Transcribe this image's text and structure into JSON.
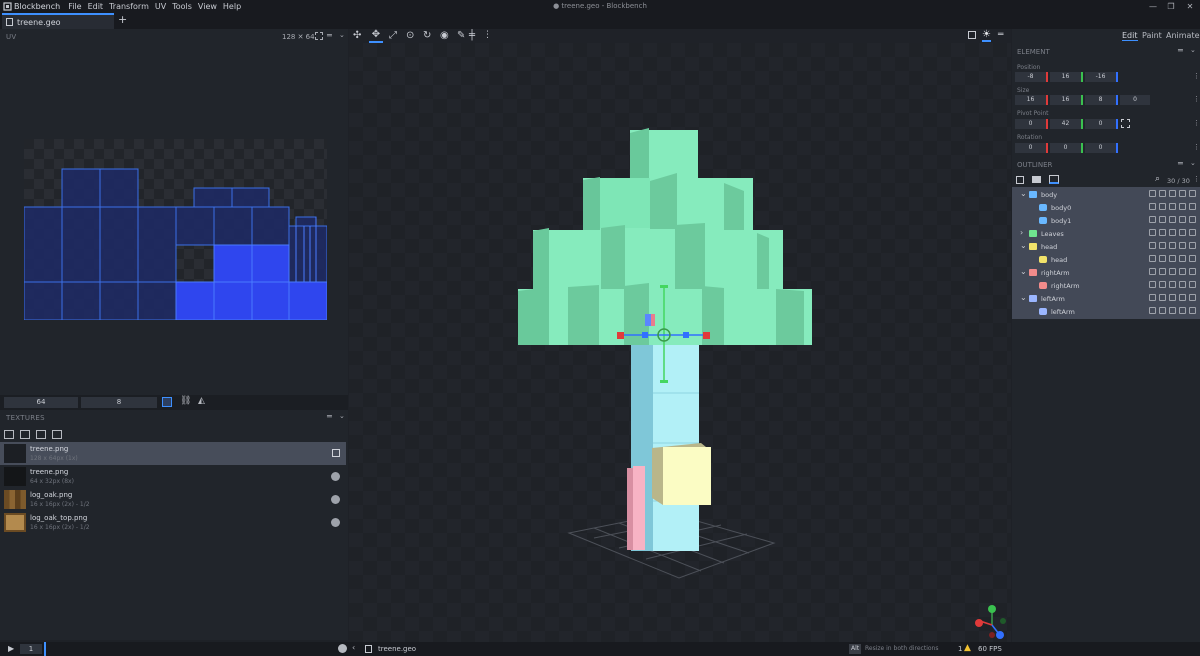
{
  "app": {
    "name": "Blockbench",
    "window_title": "● treene.geo - Blockbench",
    "menus": [
      "File",
      "Edit",
      "Transform",
      "UV",
      "Tools",
      "View",
      "Help"
    ]
  },
  "tabs": [
    {
      "label": "treene.geo"
    }
  ],
  "uv": {
    "title": "UV",
    "resolution": "128 ✕ 64",
    "footer_values": [
      "64",
      "8"
    ]
  },
  "textures": {
    "title": "TEXTURES",
    "items": [
      {
        "name": "treene.png",
        "sub": "128 x 64px (1x)",
        "selected": true
      },
      {
        "name": "treene.png",
        "sub": "64 x 32px (8x)",
        "selected": false
      },
      {
        "name": "log_oak.png",
        "sub": "16 x 16px (2x) - 1/2",
        "selected": false
      },
      {
        "name": "log_oak_top.png",
        "sub": "16 x 16px (2x) - 1/2",
        "selected": false
      }
    ]
  },
  "modes": {
    "edit": "Edit",
    "paint": "Paint",
    "animate": "Animate"
  },
  "element": {
    "title": "ELEMENT",
    "position_label": "Position",
    "position": [
      "-8",
      "16",
      "-16"
    ],
    "size_label": "Size",
    "size": [
      "16",
      "16",
      "8",
      "0"
    ],
    "pivot_label": "Pivot Point",
    "pivot": [
      "0",
      "42",
      "0"
    ],
    "rotation_label": "Rotation",
    "rotation": [
      "0",
      "0",
      "0"
    ]
  },
  "outliner": {
    "title": "OUTLINER",
    "count": "30 / 30",
    "rows": [
      {
        "name": "body",
        "type": "group",
        "depth": 0,
        "color": "#69b8ff"
      },
      {
        "name": "body0",
        "type": "cube",
        "depth": 1,
        "color": "#69b8ff"
      },
      {
        "name": "body1",
        "type": "cube",
        "depth": 1,
        "color": "#69b8ff"
      },
      {
        "name": "Leaves",
        "type": "group",
        "depth": 0,
        "color": "#6fe58f"
      },
      {
        "name": "head",
        "type": "group",
        "depth": 0,
        "color": "#f2e36a"
      },
      {
        "name": "head",
        "type": "cube",
        "depth": 1,
        "color": "#f2e36a"
      },
      {
        "name": "rightArm",
        "type": "group",
        "depth": 0,
        "color": "#f28b8b"
      },
      {
        "name": "rightArm",
        "type": "cube",
        "depth": 1,
        "color": "#f28b8b"
      },
      {
        "name": "leftArm",
        "type": "group",
        "depth": 0,
        "color": "#9bb6ff"
      },
      {
        "name": "leftArm",
        "type": "cube",
        "depth": 1,
        "color": "#9bb6ff"
      }
    ]
  },
  "status": {
    "frame": "1",
    "file": "treene.geo",
    "hint_key": "Alt",
    "hint": "Resize in both directions",
    "warnings": "1",
    "fps": "60 FPS"
  },
  "colors": {
    "accent": "#3e90ff",
    "leaves": "#7ef0b8",
    "trunk": "#a8f0f8"
  }
}
